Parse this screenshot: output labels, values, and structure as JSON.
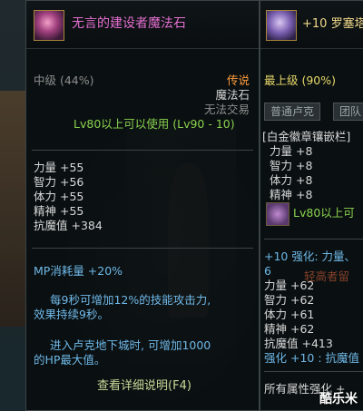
{
  "left_tooltip": {
    "item_name": "无言的建设者魔法石",
    "grade": "中级 (44%)",
    "rarity": "传说",
    "type": "魔法石",
    "trade": "无法交易",
    "level_req": "Lv80以上可以使用 (Lv90 - 10)",
    "stats": [
      {
        "label": "力量",
        "value": "+55"
      },
      {
        "label": "智力",
        "value": "+56"
      },
      {
        "label": "体力",
        "value": "+55"
      },
      {
        "label": "精神",
        "value": "+55"
      },
      {
        "label": "抗魔值",
        "value": "+384"
      }
    ],
    "mp_line": "MP消耗量 +20%",
    "desc1_line1": "每9秒可增加12%的技能攻击力,",
    "desc1_line2": "效果持续9秒。",
    "desc2_line1": "进入卢克地下城时, 可增加1000",
    "desc2_line2": "的HP最大值。",
    "more_button": "查看详细说明(F4)",
    "icon": "magic-stone-icon"
  },
  "right_tooltip": {
    "item_name": "+10 罗塞塔",
    "grade": "最上级 (90%)",
    "tab_left": "普通卢克",
    "tab_right": "团队",
    "socket_title": "[白金徽章镶嵌栏]",
    "stats": [
      {
        "label": "力量",
        "value": "+8"
      },
      {
        "label": "智力",
        "value": "+8"
      },
      {
        "label": "体力",
        "value": "+8"
      },
      {
        "label": "精神",
        "value": "+8"
      }
    ],
    "level_req": "Lv80以上可",
    "reinforce": "+10 强化: 力量、",
    "reinforce_cont": "6",
    "faint_text": "轻高者留",
    "stats2": [
      {
        "label": "力量",
        "value": "+62"
      },
      {
        "label": "智力",
        "value": "+62"
      },
      {
        "label": "体力",
        "value": "+61"
      },
      {
        "label": "精神",
        "value": "+62"
      },
      {
        "label": "抗魔值",
        "value": "+413"
      }
    ],
    "reinforce2": "强化 +10 : 抗魔值",
    "all_attr": "所有属性强化 +",
    "icon": "crown-icon"
  },
  "watermark": "酷乐米",
  "colors": {
    "legendary": "#ff9a3c",
    "level_req": "#8ad24e",
    "stat": "#d8d8d8",
    "skill_desc": "#6fb8e8",
    "grade": "#e8d86a",
    "item_name_left": "#e46fd0",
    "item_name_right": "#f2d98a"
  }
}
